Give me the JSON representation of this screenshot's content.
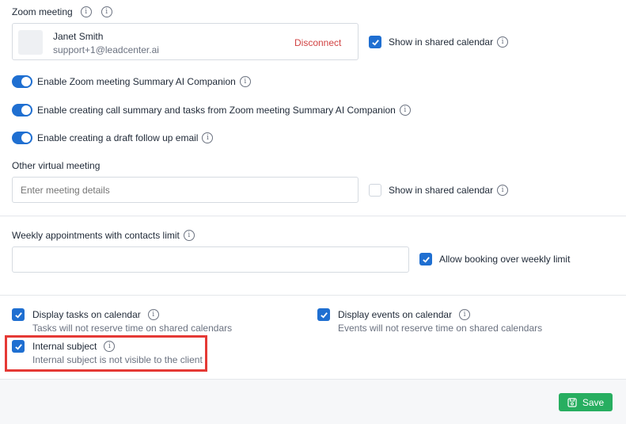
{
  "zoom": {
    "heading": "Zoom meeting",
    "account_name": "Janet Smith",
    "account_email": "support+1@leadcenter.ai",
    "disconnect_label": "Disconnect",
    "show_shared_label": "Show in shared calendar",
    "show_shared_checked": true
  },
  "toggles": [
    {
      "label": "Enable Zoom meeting Summary AI Companion",
      "on": true
    },
    {
      "label": "Enable creating call summary and tasks from Zoom meeting Summary AI Companion",
      "on": true
    },
    {
      "label": "Enable creating a draft follow up email",
      "on": true
    }
  ],
  "other_virtual": {
    "heading": "Other virtual meeting",
    "placeholder": "Enter meeting details",
    "show_shared_label": "Show in shared calendar",
    "show_shared_checked": false
  },
  "weekly": {
    "heading": "Weekly appointments with contacts limit",
    "value": "",
    "allow_over_label": "Allow booking over weekly limit",
    "allow_over_checked": true
  },
  "options": {
    "tasks_label": "Display tasks on calendar",
    "tasks_desc": "Tasks will not reserve time on shared calendars",
    "events_label": "Display events on calendar",
    "events_desc": "Events will not reserve time on shared calendars",
    "internal_label": "Internal subject",
    "internal_desc": "Internal subject is not visible to the client"
  },
  "footer": {
    "save_label": "Save"
  },
  "colors": {
    "accent": "#1f6fd1",
    "disconnect": "#d14343",
    "save": "#27ae60",
    "highlight": "#e53935"
  }
}
